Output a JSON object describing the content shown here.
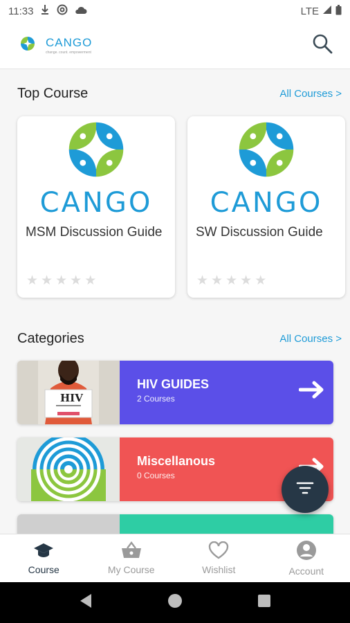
{
  "status_bar": {
    "time": "11:33",
    "network": "LTE"
  },
  "header": {
    "brand_name": "CANGO",
    "brand_tagline": "change. count. empowerment"
  },
  "top_course": {
    "title": "Top Course",
    "link": "All Courses >",
    "courses": [
      {
        "logo_text": "CANGO",
        "name": "MSM Discussion Guide",
        "rating": 0
      },
      {
        "logo_text": "CANGO",
        "name": "SW Discussion Guide",
        "rating": 0
      }
    ]
  },
  "categories": {
    "title": "Categories",
    "link": "All Courses >",
    "items": [
      {
        "title": "HIV GUIDES",
        "count": "2 Courses",
        "thumb_text": "HIV",
        "color": "#5b4fe8"
      },
      {
        "title": "Miscellanous",
        "count": "0 Courses",
        "color": "#f05454"
      },
      {
        "title": "",
        "count": "",
        "color": "#2ecda4"
      }
    ]
  },
  "bottom_nav": {
    "items": [
      {
        "label": "Course",
        "icon": "graduation-cap-icon",
        "active": true
      },
      {
        "label": "My Course",
        "icon": "basket-icon",
        "active": false
      },
      {
        "label": "Wishlist",
        "icon": "heart-icon",
        "active": false
      },
      {
        "label": "Account",
        "icon": "account-icon",
        "active": false
      }
    ]
  },
  "colors": {
    "brand_blue": "#1e9bd7",
    "brand_green": "#8cc63f",
    "fab": "#263746"
  }
}
